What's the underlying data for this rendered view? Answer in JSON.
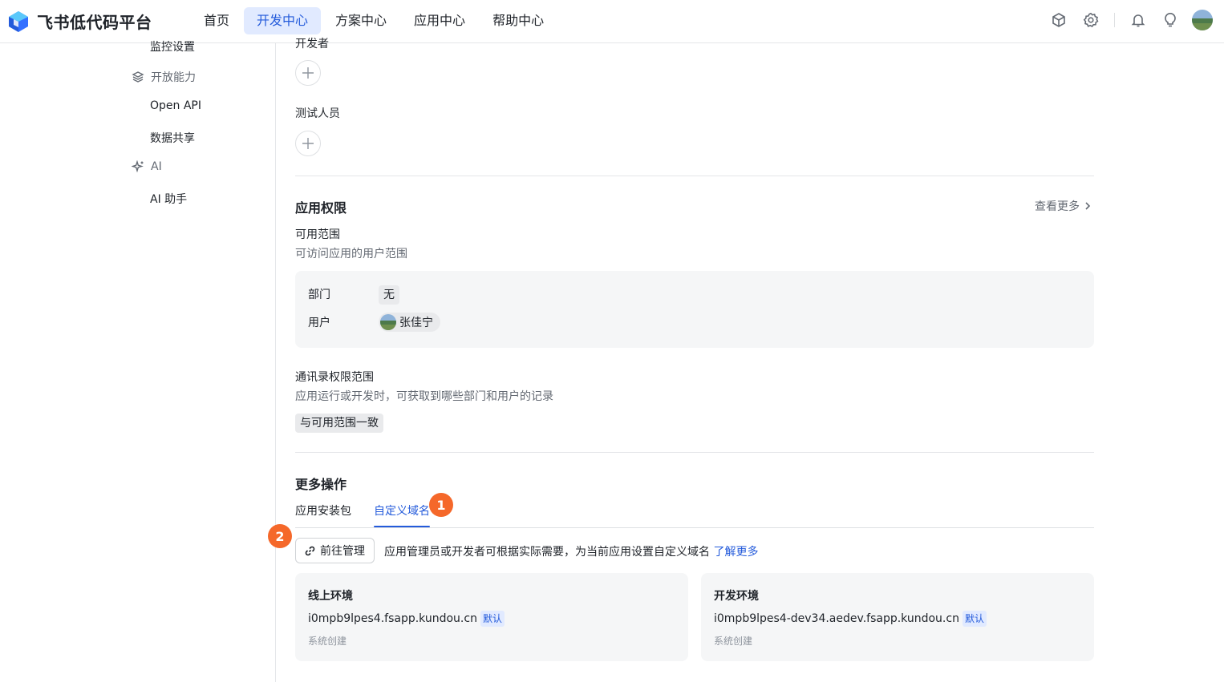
{
  "header": {
    "brand": "飞书低代码平台",
    "nav": [
      {
        "label": "首页"
      },
      {
        "label": "开发中心",
        "active": true
      },
      {
        "label": "方案中心"
      },
      {
        "label": "应用中心"
      },
      {
        "label": "帮助中心"
      }
    ],
    "tools": [
      "cube-icon",
      "gear-icon",
      "bell-icon",
      "lightbulb-icon",
      "user-avatar"
    ]
  },
  "sidebar": {
    "cut_item": "监控设置",
    "groups": [
      {
        "label": "开放能力",
        "icon": "layers-icon",
        "items": [
          "Open API",
          "数据共享"
        ]
      },
      {
        "label": "AI",
        "icon": "sparkle-icon",
        "items": [
          "AI 助手"
        ]
      }
    ]
  },
  "members": {
    "cut_label": "开发者",
    "testers_label": "测试人员"
  },
  "permissions": {
    "title": "应用权限",
    "more": "查看更多",
    "scope_title": "可用范围",
    "scope_desc": "可访问应用的用户范围",
    "dept_label": "部门",
    "dept_value": "无",
    "user_label": "用户",
    "user_value": "张佳宁",
    "contacts_title": "通讯录权限范围",
    "contacts_desc": "应用运行或开发时，可获取到哪些部门和用户的记录",
    "contacts_value": "与可用范围一致"
  },
  "more_ops": {
    "title": "更多操作",
    "tabs": [
      {
        "label": "应用安装包"
      },
      {
        "label": "自定义域名",
        "active": true
      }
    ],
    "badge1": "1",
    "badge2": "2",
    "manage_button": "前往管理",
    "desc": "应用管理员或开发者可根据实际需要，为当前应用设置自定义域名",
    "learn_more": "了解更多",
    "envs": [
      {
        "title": "线上环境",
        "domain": "i0mpb9lpes4.fsapp.kundou.cn",
        "tag": "默认",
        "note": "系统创建"
      },
      {
        "title": "开发环境",
        "domain": "i0mpb9lpes4-dev34.aedev.fsapp.kundou.cn",
        "tag": "默认",
        "note": "系统创建"
      }
    ]
  },
  "colors": {
    "accent": "#245bdb",
    "badge": "#f5682a",
    "nav_active_bg": "#e1eaff"
  }
}
